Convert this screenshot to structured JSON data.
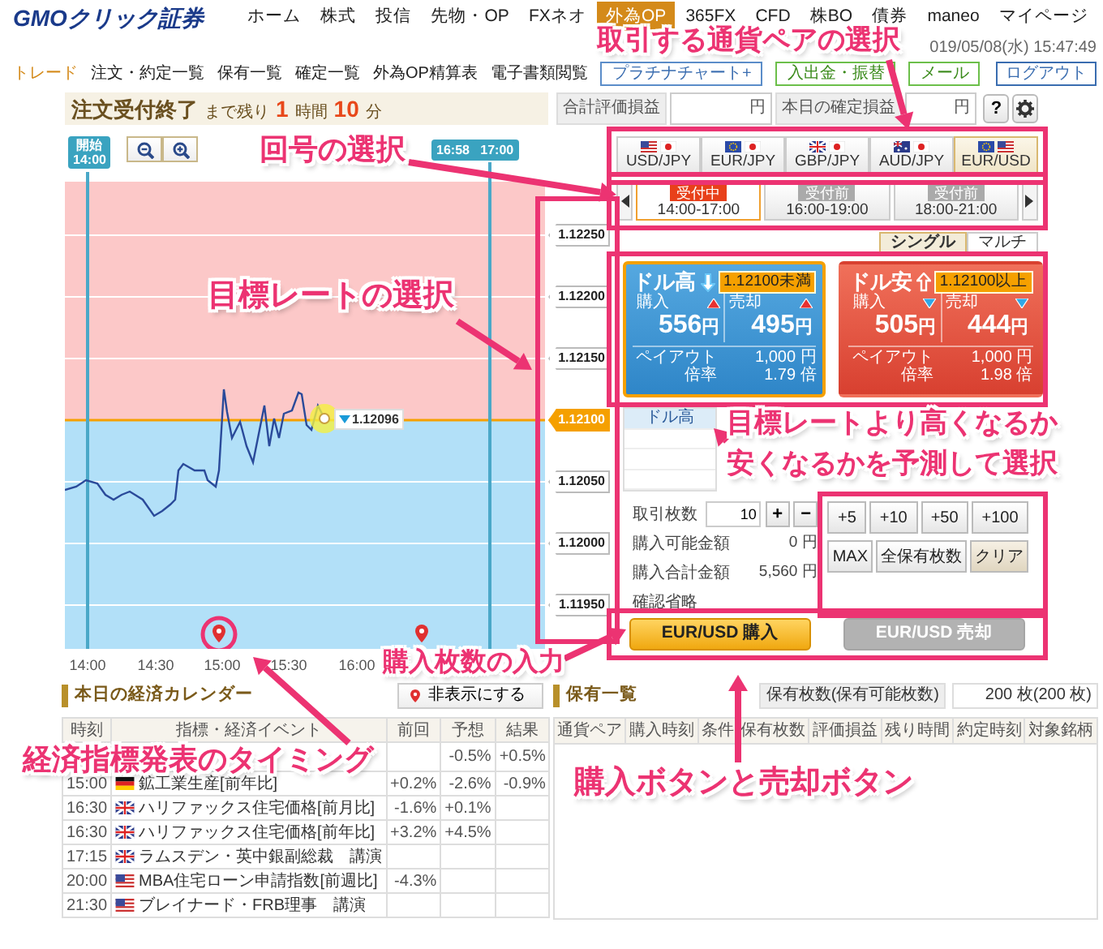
{
  "header": {
    "logo": "GMOクリック証券",
    "nav": [
      {
        "label": "ホーム",
        "selected": false
      },
      {
        "label": "株式",
        "selected": false
      },
      {
        "label": "投信",
        "selected": false
      },
      {
        "label": "先物・OP",
        "selected": false
      },
      {
        "label": "FXネオ",
        "selected": false
      },
      {
        "label": "外為OP",
        "selected": true
      },
      {
        "label": "365FX",
        "selected": false
      },
      {
        "label": "CFD",
        "selected": false
      },
      {
        "label": "株BO",
        "selected": false
      },
      {
        "label": "債券",
        "selected": false
      },
      {
        "label": "maneo",
        "selected": false
      },
      {
        "label": "マイページ",
        "selected": false
      }
    ]
  },
  "subnav": {
    "items": [
      {
        "label": "トレード",
        "selected": true
      },
      {
        "label": "注文・約定一覧",
        "selected": false
      },
      {
        "label": "保有一覧",
        "selected": false
      },
      {
        "label": "確定一覧",
        "selected": false
      },
      {
        "label": "外為OP精算表",
        "selected": false
      },
      {
        "label": "電子書類閲覧",
        "selected": false
      }
    ],
    "buttons": [
      {
        "label": "プラチナチャート+",
        "kind": "chart"
      },
      {
        "label": "入出金・振替",
        "kind": "account"
      },
      {
        "label": "メール",
        "kind": "account"
      }
    ],
    "datetime": "019/05/08(水) 15:47:49",
    "logout": "ログアウト"
  },
  "status": {
    "title": "注文受付終了",
    "remaining_label": "まで残り",
    "hours": "1",
    "hours_unit": "時間",
    "minutes": "10",
    "minutes_unit": "分"
  },
  "totals": [
    {
      "label": "合計評価損益",
      "unit": "円"
    },
    {
      "label": "本日の確定損益",
      "unit": "円"
    }
  ],
  "help": "?",
  "chart": {
    "start_tag": {
      "label": "開始",
      "time": "14:00"
    },
    "end_tag": [
      "16:58",
      "17:00"
    ],
    "price_label": "1.12096",
    "x_labels": [
      "14:00",
      "14:30",
      "15:00",
      "15:30",
      "16:00"
    ]
  },
  "rate_ladder": [
    {
      "rate": "1.12250",
      "selected": false
    },
    {
      "rate": "1.12200",
      "selected": false
    },
    {
      "rate": "1.12150",
      "selected": false
    },
    {
      "rate": "1.12100",
      "selected": true
    },
    {
      "rate": "1.12050",
      "selected": false
    },
    {
      "rate": "1.12000",
      "selected": false
    },
    {
      "rate": "1.11950",
      "selected": false
    }
  ],
  "currency_tabs": [
    {
      "label": "USD/JPY",
      "kind": "usdjpy",
      "selected": false
    },
    {
      "label": "EUR/JPY",
      "kind": "eurjpy",
      "selected": false
    },
    {
      "label": "GBP/JPY",
      "kind": "gbpjpy",
      "selected": false
    },
    {
      "label": "AUD/JPY",
      "kind": "audjpy",
      "selected": false
    },
    {
      "label": "EUR/USD",
      "kind": "eurusd",
      "selected": true
    }
  ],
  "sessions": [
    {
      "status": "受付中",
      "time": "14:00-17:00",
      "open": true,
      "selected": true
    },
    {
      "status": "受付前",
      "time": "16:00-19:00",
      "open": false,
      "selected": false
    },
    {
      "status": "受付前",
      "time": "18:00-21:00",
      "open": false,
      "selected": false
    }
  ],
  "mode_toggle": [
    {
      "label": "シングル",
      "selected": true
    },
    {
      "label": "マルチ",
      "selected": false
    }
  ],
  "options": [
    {
      "kind": "high",
      "title": "ドル高",
      "target": "1.12100未満",
      "buy_label": "購入",
      "sell_label": "売却",
      "buy_price": "556",
      "buy_unit": "円",
      "sell_price": "495",
      "sell_unit": "円",
      "payout_label": "ペイアウト",
      "payout": "1,000",
      "payout_unit": "円",
      "ratio_label": "倍率",
      "ratio": "1.79",
      "ratio_unit": "倍",
      "selected": true
    },
    {
      "kind": "low",
      "title": "ドル安",
      "target": "1.12100以上",
      "buy_label": "購入",
      "sell_label": "売却",
      "buy_price": "505",
      "buy_unit": "円",
      "sell_price": "444",
      "sell_unit": "円",
      "payout_label": "ペイアウト",
      "payout": "1,000",
      "payout_unit": "円",
      "ratio_label": "倍率",
      "ratio": "1.98",
      "ratio_unit": "倍",
      "selected": false
    }
  ],
  "order_table": {
    "header": "ドル高"
  },
  "quantity": {
    "label": "取引枚数",
    "value": "10",
    "plus": "+",
    "minus": "−",
    "presets": [
      "+5",
      "+10",
      "+50",
      "+100"
    ],
    "actions": [
      "MAX",
      "全保有枚数",
      "クリア"
    ],
    "available_label": "購入可能金額",
    "available": "0 円",
    "total_label": "購入合計金額",
    "total": "5,560 円",
    "skip_confirm": "確認省略"
  },
  "trade_buttons": [
    {
      "label": "EUR/USD 購入",
      "kind": "buy",
      "disabled": false
    },
    {
      "label": "EUR/USD 売却",
      "kind": "sell",
      "disabled": true
    }
  ],
  "calendar": {
    "title": "本日の経済カレンダー",
    "hide_button": "非表示にする",
    "columns": [
      "時刻",
      "指標・経済イベント",
      "前回",
      "予想",
      "結果"
    ],
    "rows": [
      {
        "forecast": "-0.5%",
        "result": "+0.5%"
      },
      {
        "time": "15:00",
        "kind": "de",
        "event": "鉱工業生産[前年比]",
        "previous": "+0.2%",
        "forecast": "-2.6%",
        "result": "-0.9%"
      },
      {
        "time": "16:30",
        "kind": "gb",
        "event": "ハリファックス住宅価格[前月比]",
        "previous": "-1.6%",
        "forecast": "+0.1%"
      },
      {
        "time": "16:30",
        "kind": "gb",
        "event": "ハリファックス住宅価格[前年比]",
        "previous": "+3.2%",
        "forecast": "+4.5%"
      },
      {
        "time": "17:15",
        "kind": "gb",
        "event": "ラムスデン・英中銀副総裁　講演"
      },
      {
        "time": "20:00",
        "kind": "us",
        "event": "MBA住宅ローン申請指数[前週比]",
        "previous": "-4.3%"
      },
      {
        "time": "21:30",
        "kind": "us",
        "event": "ブレイナード・FRB理事　講演"
      }
    ]
  },
  "holdings": {
    "title": "保有一覧",
    "count_label": "保有枚数(保有可能枚数)",
    "count": "200 枚(200 枚)",
    "columns": [
      "通貨ペア",
      "購入時刻",
      "条件",
      "保有枚数",
      "評価損益",
      "残り時間",
      "約定時刻",
      "対象銘柄"
    ]
  },
  "annotations": [
    {
      "lines": [
        "取引する通貨ペアの選択"
      ]
    },
    {
      "lines": [
        "回号の選択"
      ]
    },
    {
      "lines": [
        "目標レートの選択"
      ]
    },
    {
      "lines": [
        "目標レートより高くなるか",
        "安くなるかを予測して選択"
      ]
    },
    {
      "lines": [
        "購入枚数の入力"
      ]
    },
    {
      "lines": [
        "経済指標発表のタイミング"
      ]
    },
    {
      "lines": [
        "購入ボタンと売却ボタン"
      ]
    }
  ]
}
